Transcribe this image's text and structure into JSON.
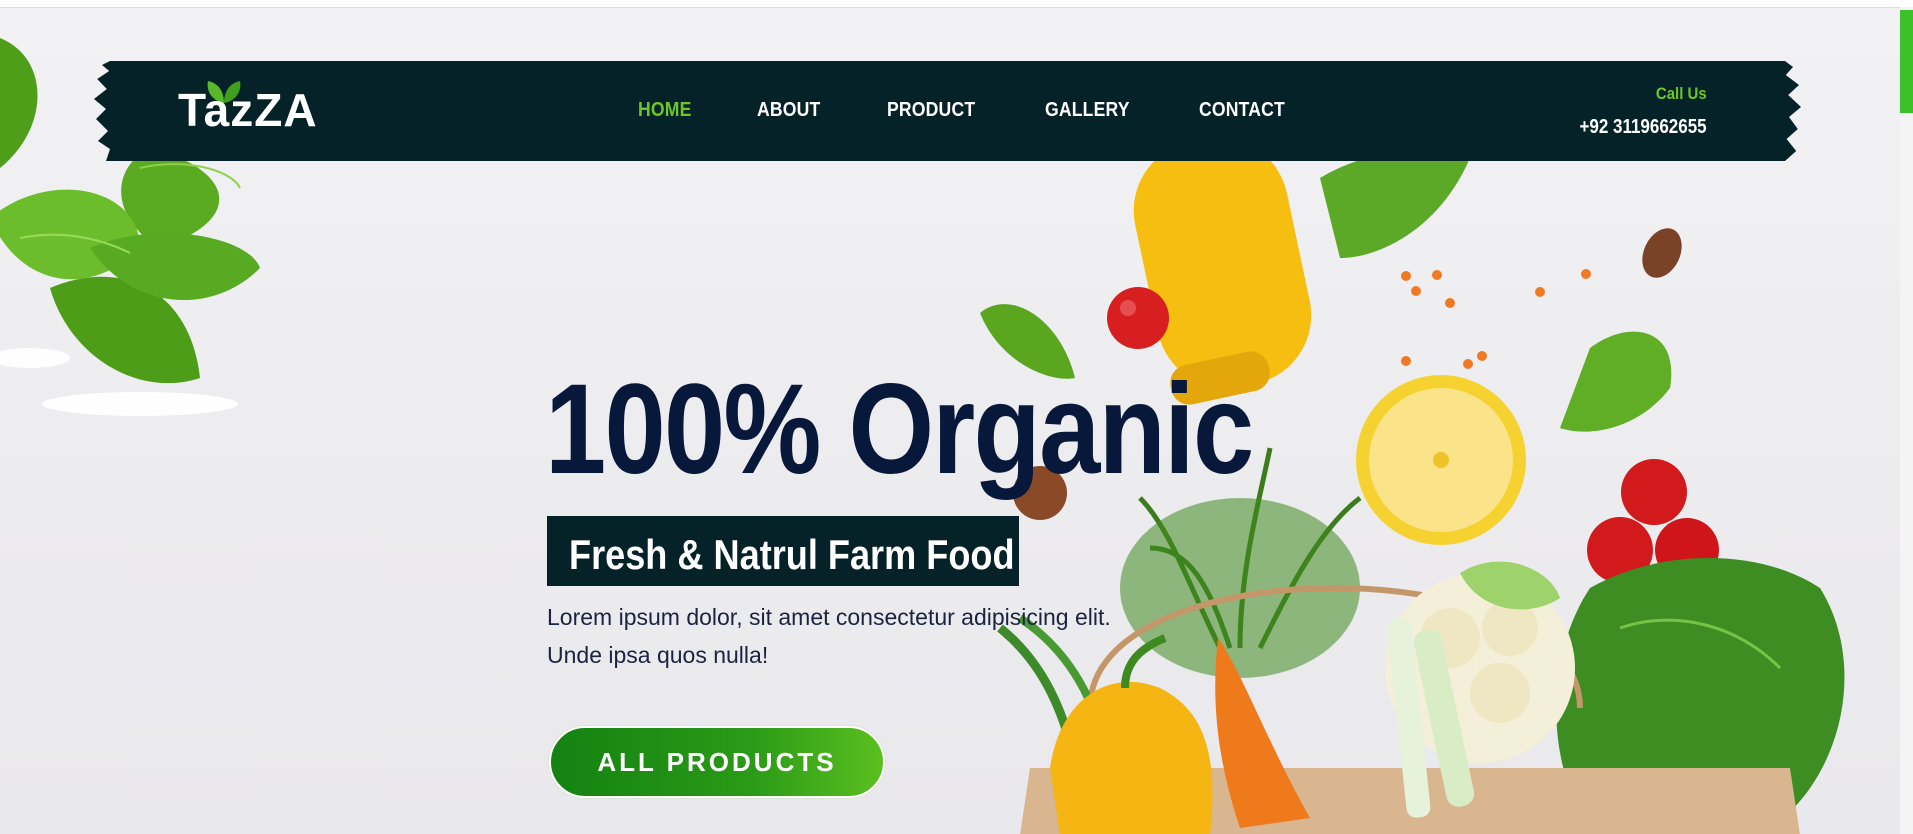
{
  "brand": {
    "name": "TazZA"
  },
  "nav": {
    "items": [
      {
        "label": "HOME",
        "active": true
      },
      {
        "label": "ABOUT",
        "active": false
      },
      {
        "label": "PRODUCT",
        "active": false
      },
      {
        "label": "GALLERY",
        "active": false
      },
      {
        "label": "CONTACT",
        "active": false
      }
    ]
  },
  "contact": {
    "label": "Call Us",
    "phone": "+92 3119662655"
  },
  "hero": {
    "headline": "100% Organic",
    "tagline": "Fresh & Natrul Farm Food",
    "description_line1": "Lorem ipsum dolor, sit amet consectetur adipisicing elit.",
    "description_line2": "Unde ipsa quos nulla!",
    "cta_label": "ALL PRODUCTS"
  },
  "colors": {
    "navy": "#062229",
    "accent_green": "#6cc727",
    "headline": "#07183a",
    "button_start": "#138211",
    "button_end": "#5bbf1f"
  },
  "icons": [
    "leaf-logo-icon",
    "vegetable-basket-image",
    "spinach-leaves-image"
  ]
}
